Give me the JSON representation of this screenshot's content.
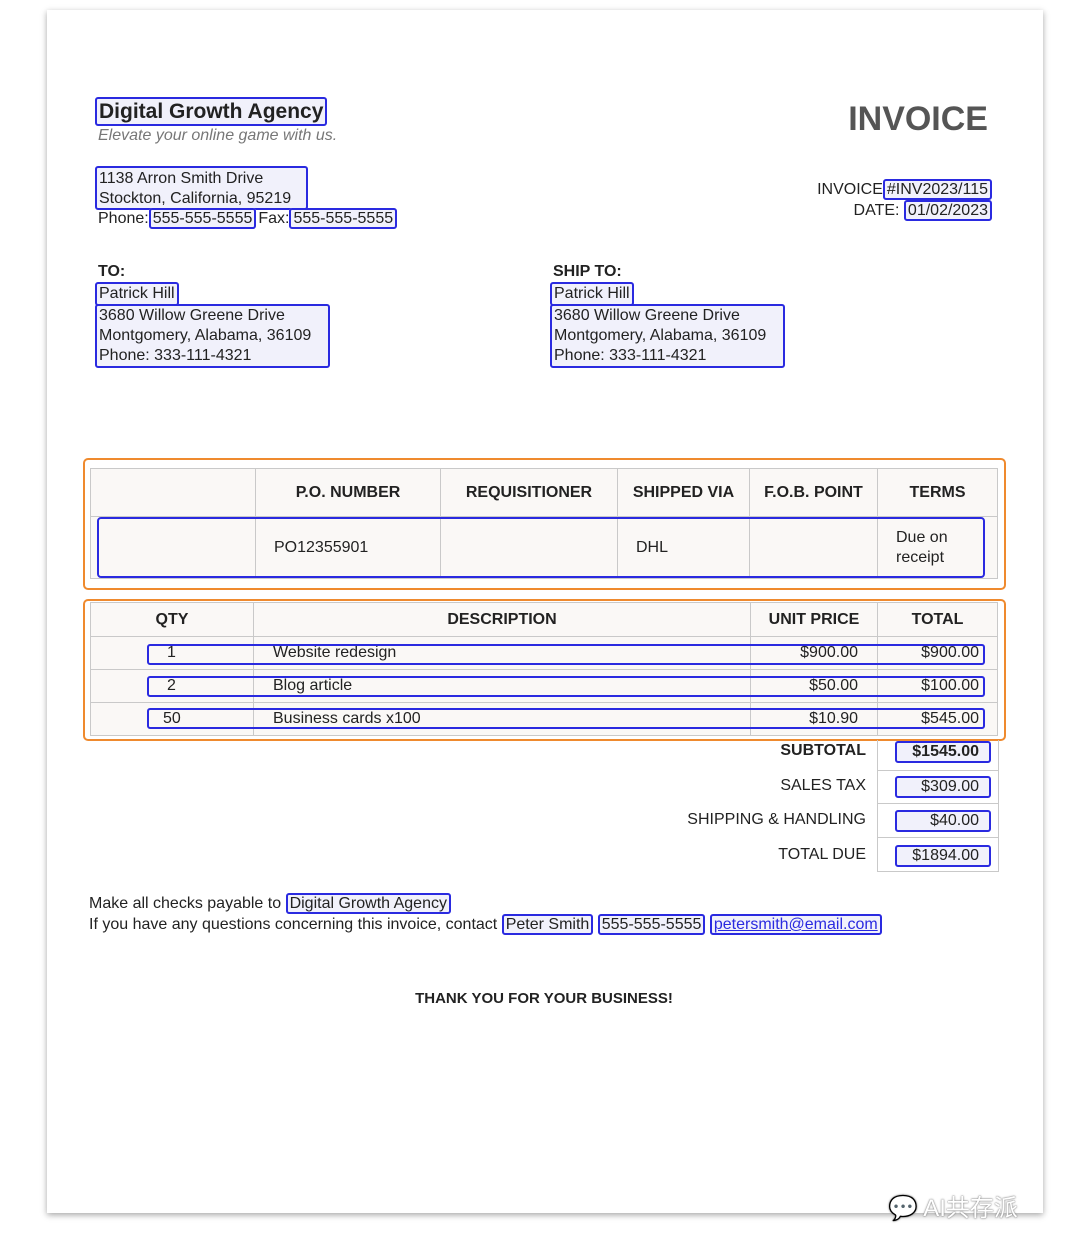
{
  "company": {
    "name": "Digital Growth Agency",
    "tagline": "Elevate your online game with us.",
    "address1": "1138 Arron Smith Drive",
    "address2": "Stockton, California, 95219",
    "phone_label": "Phone:",
    "phone": "555-555-5555",
    "fax_label": "Fax:",
    "fax": "555-555-5555"
  },
  "invoice": {
    "title": "INVOICE",
    "number_label": "INVOICE",
    "number": "#INV2023/115",
    "date_label": "DATE:",
    "date": "01/02/2023"
  },
  "to": {
    "label": "TO:",
    "name": "Patrick Hill",
    "address1": "3680 Willow Greene Drive",
    "address2": "Montgomery, Alabama, 36109",
    "phone": "Phone: 333-111-4321"
  },
  "ship_to": {
    "label": "SHIP TO:",
    "name": "Patrick Hill",
    "address1": "3680 Willow Greene Drive",
    "address2": "Montgomery, Alabama, 36109",
    "phone": "Phone: 333-111-4321"
  },
  "order_table": {
    "headers": [
      "",
      "P.O. NUMBER",
      "REQUISITIONER",
      "SHIPPED VIA",
      "F.O.B. POINT",
      "TERMS"
    ],
    "row": [
      "",
      "PO12355901",
      "",
      "DHL",
      "",
      "Due on receipt"
    ]
  },
  "items_table": {
    "headers": [
      "QTY",
      "DESCRIPTION",
      "UNIT PRICE",
      "TOTAL"
    ],
    "rows": [
      [
        "1",
        "Website redesign",
        "$900.00",
        "$900.00"
      ],
      [
        "2",
        "Blog article",
        "$50.00",
        "$100.00"
      ],
      [
        "50",
        "Business cards x100",
        "$10.90",
        "$545.00"
      ]
    ]
  },
  "totals": [
    {
      "label": "SUBTOTAL",
      "value": "$1545.00"
    },
    {
      "label": "SALES TAX",
      "value": "$309.00"
    },
    {
      "label": "SHIPPING & HANDLING",
      "value": "$40.00"
    },
    {
      "label": "TOTAL DUE",
      "value": "$1894.00"
    }
  ],
  "footer": {
    "checks_text": "Make all checks payable to",
    "checks_payee": "Digital Growth Agency",
    "contact_text": "If you have any questions concerning this invoice, contact",
    "contact_name": "Peter Smith",
    "contact_phone": "555-555-5555",
    "contact_email": "petersmith@email.com",
    "thanks": "THANK YOU FOR YOUR BUSINESS!"
  },
  "watermark": "AI共存派",
  "colors": {
    "annotation_box": "#2a2ae0",
    "table_group_box": "#ef8a2e"
  }
}
